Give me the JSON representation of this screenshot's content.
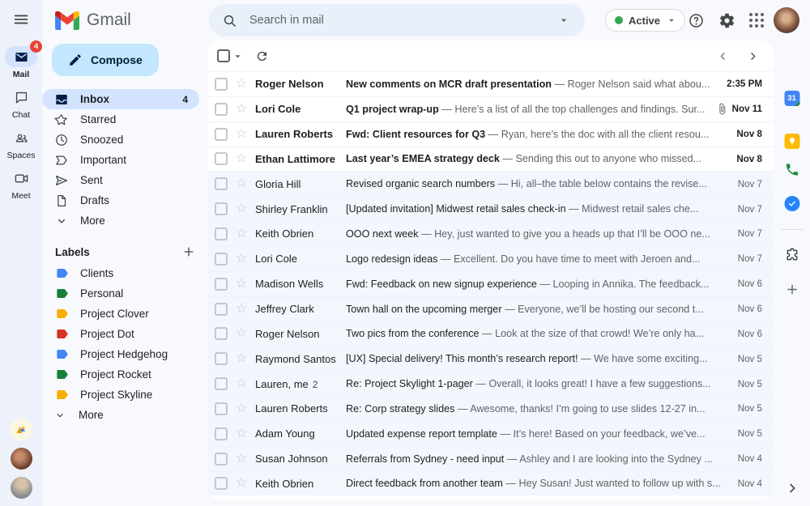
{
  "app": {
    "logo_text": "Gmail"
  },
  "colors": {
    "compose_bg": "#c2e7ff",
    "selected_bg": "#d3e3fd",
    "badge_red": "#e94235",
    "status_green": "#34a853",
    "unread_text": "#1f1f1f",
    "read_bg": "#f3f6fc"
  },
  "left_rail": {
    "items": [
      {
        "label": "Mail",
        "icon": "mail-icon",
        "badge": "4",
        "active": true
      },
      {
        "label": "Chat",
        "icon": "chat-icon",
        "badge": "",
        "active": false
      },
      {
        "label": "Spaces",
        "icon": "spaces-icon",
        "badge": "",
        "active": false
      },
      {
        "label": "Meet",
        "icon": "meet-icon",
        "badge": "",
        "active": false
      }
    ]
  },
  "sidebar": {
    "compose_label": "Compose",
    "nav": [
      {
        "label": "Inbox",
        "icon": "inbox-icon",
        "count": "4",
        "active": true
      },
      {
        "label": "Starred",
        "icon": "star-icon",
        "count": "",
        "active": false
      },
      {
        "label": "Snoozed",
        "icon": "clock-icon",
        "count": "",
        "active": false
      },
      {
        "label": "Important",
        "icon": "important-icon",
        "count": "",
        "active": false
      },
      {
        "label": "Sent",
        "icon": "send-icon",
        "count": "",
        "active": false
      },
      {
        "label": "Drafts",
        "icon": "draft-icon",
        "count": "",
        "active": false
      },
      {
        "label": "More",
        "icon": "chevron-down-icon",
        "count": "",
        "active": false
      }
    ],
    "labels_header": "Labels",
    "labels": [
      {
        "name": "Clients",
        "color": "#4285f4"
      },
      {
        "name": "Personal",
        "color": "#188038"
      },
      {
        "name": "Project Clover",
        "color": "#f9ab00"
      },
      {
        "name": "Project Dot",
        "color": "#d93025"
      },
      {
        "name": "Project Hedgehog",
        "color": "#4285f4"
      },
      {
        "name": "Project Rocket",
        "color": "#188038"
      },
      {
        "name": "Project Skyline",
        "color": "#f9ab00"
      }
    ],
    "labels_more": "More"
  },
  "topbar": {
    "search_placeholder": "Search in mail",
    "status_label": "Active",
    "icons": [
      "help-icon",
      "settings-icon",
      "apps-icon",
      "profile-avatar"
    ]
  },
  "side_panel": {
    "calendar_label": "31",
    "icons": [
      "calendar-icon",
      "keep-icon",
      "voice-icon",
      "tasks-icon",
      "addons-icon",
      "add-icon"
    ]
  },
  "list": {
    "rows": [
      {
        "sender": "Roger Nelson",
        "count": "",
        "subject": "New comments on MCR draft presentation",
        "snippet": "Roger Nelson said what abou...",
        "date": "2:35 PM",
        "unread": true,
        "attachment": false
      },
      {
        "sender": "Lori Cole",
        "count": "",
        "subject": "Q1 project wrap-up",
        "snippet": "Here’s a list of all the top challenges and findings. Sur...",
        "date": "Nov 11",
        "unread": true,
        "attachment": true
      },
      {
        "sender": "Lauren Roberts",
        "count": "",
        "subject": "Fwd: Client resources for Q3",
        "snippet": "Ryan, here’s the doc with all the client resou...",
        "date": "Nov 8",
        "unread": true,
        "attachment": false
      },
      {
        "sender": "Ethan Lattimore",
        "count": "",
        "subject": "Last year’s EMEA strategy deck",
        "snippet": "Sending this out to anyone who missed...",
        "date": "Nov 8",
        "unread": true,
        "attachment": false
      },
      {
        "sender": "Gloria Hill",
        "count": "",
        "subject": "Revised organic search numbers",
        "snippet": "Hi, all–the table below contains the revise...",
        "date": "Nov 7",
        "unread": false,
        "attachment": false
      },
      {
        "sender": "Shirley Franklin",
        "count": "",
        "subject": "[Updated invitation] Midwest retail sales check-in",
        "snippet": "Midwest retail sales che...",
        "date": "Nov 7",
        "unread": false,
        "attachment": false
      },
      {
        "sender": "Keith Obrien",
        "count": "",
        "subject": "OOO next week",
        "snippet": "Hey, just wanted to give you a heads up that I’ll be OOO ne...",
        "date": "Nov 7",
        "unread": false,
        "attachment": false
      },
      {
        "sender": "Lori Cole",
        "count": "",
        "subject": "Logo redesign ideas",
        "snippet": "Excellent. Do you have time to meet with Jeroen and...",
        "date": "Nov 7",
        "unread": false,
        "attachment": false
      },
      {
        "sender": "Madison Wells",
        "count": "",
        "subject": "Fwd: Feedback on new signup experience",
        "snippet": "Looping in Annika. The feedback...",
        "date": "Nov 6",
        "unread": false,
        "attachment": false
      },
      {
        "sender": "Jeffrey Clark",
        "count": "",
        "subject": "Town hall on the upcoming merger",
        "snippet": "Everyone, we’ll be hosting our second t...",
        "date": "Nov 6",
        "unread": false,
        "attachment": false
      },
      {
        "sender": "Roger Nelson",
        "count": "",
        "subject": "Two pics from the conference",
        "snippet": "Look at the size of that crowd! We’re only ha...",
        "date": "Nov 6",
        "unread": false,
        "attachment": false
      },
      {
        "sender": "Raymond Santos",
        "count": "",
        "subject": "[UX] Special delivery! This month’s research report!",
        "snippet": "We have some exciting...",
        "date": "Nov 5",
        "unread": false,
        "attachment": false
      },
      {
        "sender": "Lauren, me",
        "count": "2",
        "subject": "Re: Project Skylight 1-pager",
        "snippet": "Overall, it looks great! I have a few suggestions...",
        "date": "Nov 5",
        "unread": false,
        "attachment": false
      },
      {
        "sender": "Lauren Roberts",
        "count": "",
        "subject": "Re: Corp strategy slides",
        "snippet": "Awesome, thanks! I’m going to use slides 12-27 in...",
        "date": "Nov 5",
        "unread": false,
        "attachment": false
      },
      {
        "sender": "Adam Young",
        "count": "",
        "subject": "Updated expense report template",
        "snippet": "It’s here! Based on your feedback, we’ve...",
        "date": "Nov 5",
        "unread": false,
        "attachment": false
      },
      {
        "sender": "Susan Johnson",
        "count": "",
        "subject": "Referrals from Sydney - need input",
        "snippet": "Ashley and I are looking into the Sydney ...",
        "date": "Nov 4",
        "unread": false,
        "attachment": false
      },
      {
        "sender": "Keith Obrien",
        "count": "",
        "subject": "Direct feedback from another team",
        "snippet": "Hey Susan! Just wanted to follow up with s...",
        "date": "Nov 4",
        "unread": false,
        "attachment": false
      }
    ]
  }
}
